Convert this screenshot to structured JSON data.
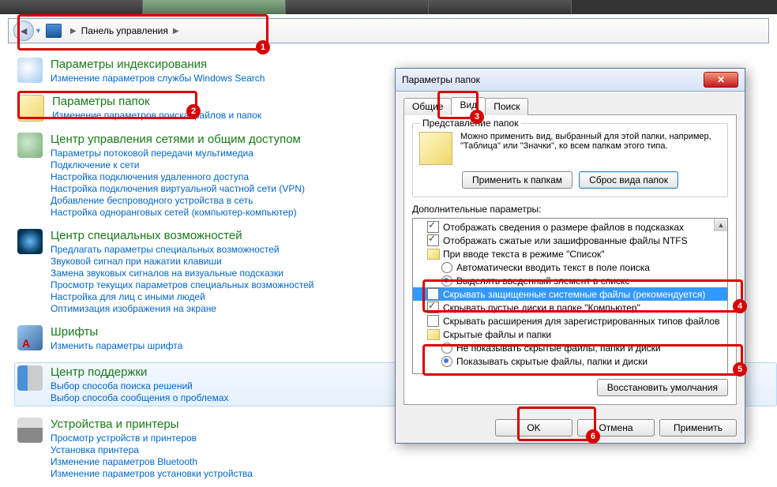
{
  "browser": {
    "tab_count": 4
  },
  "breadcrumb": {
    "control_panel": "Панель управления"
  },
  "categories": [
    {
      "id": "indexing",
      "icon": "ic-search",
      "title": "Параметры индексирования",
      "links": [
        "Изменение параметров службы Windows Search"
      ]
    },
    {
      "id": "folder-options",
      "icon": "ic-folder",
      "title": "Параметры папок",
      "links": [
        "Изменение параметров поиска файлов и папок"
      ]
    },
    {
      "id": "network",
      "icon": "ic-network",
      "title": "Центр управления сетями и общим доступом",
      "links": [
        "Параметры потоковой передачи мультимедиа",
        "Подключение к сети",
        "Настройка подключения удаленного доступа",
        "Настройка подключения виртуальной частной сети (VPN)",
        "Добавление беспроводного устройства в сеть",
        "Настройка одноранговых сетей (компьютер-компьютер)"
      ]
    },
    {
      "id": "ease-access",
      "icon": "ic-access",
      "title": "Центр специальных возможностей",
      "links": [
        "Предлагать параметры специальных возможностей",
        "Звуковой сигнал при нажатии клавиши",
        "Замена звуковых сигналов на визуальные подсказки",
        "Просмотр текущих параметров специальных возможностей",
        "Настройка для лиц с иными людей",
        "Оптимизация изображения на экране"
      ]
    },
    {
      "id": "fonts",
      "icon": "ic-fonts",
      "title": "Шрифты",
      "links": [
        "Изменить параметры шрифта"
      ]
    },
    {
      "id": "action-center",
      "icon": "ic-flag",
      "title": "Центр поддержки",
      "selected": true,
      "links": [
        "Выбор способа поиска решений",
        "Выбор способа сообщения о проблемах"
      ]
    },
    {
      "id": "devices",
      "icon": "ic-printer",
      "title": "Устройства и принтеры",
      "links": [
        "Просмотр устройств и принтеров",
        "Установка принтера",
        "Изменение параметров Bluetooth",
        "Изменение параметров установки устройства"
      ]
    }
  ],
  "dialog": {
    "title": "Параметры папок",
    "tabs": {
      "general": "Общие",
      "view": "Вид",
      "search": "Поиск"
    },
    "group_title": "Представление папок",
    "group_text": "Можно применить вид, выбранный для этой папки, например, \"Таблица\" или \"Значки\", ко всем папкам этого типа.",
    "apply_to_folders": "Применить к папкам",
    "reset_folders": "Сброс вида папок",
    "advanced_label": "Дополнительные параметры:",
    "tree": [
      {
        "type": "chk",
        "checked": true,
        "indent": 1,
        "label": "Отображать сведения о размере файлов в подсказках"
      },
      {
        "type": "chk",
        "checked": true,
        "indent": 1,
        "label": "Отображать сжатые или зашифрованные файлы NTFS"
      },
      {
        "type": "folder",
        "indent": 1,
        "label": "При вводе текста в режиме \"Список\""
      },
      {
        "type": "radio",
        "checked": false,
        "indent": 2,
        "label": "Автоматически вводить текст в поле поиска"
      },
      {
        "type": "radio",
        "checked": true,
        "indent": 2,
        "label": "Выделять введенный элемент в списке"
      },
      {
        "type": "chk",
        "checked": false,
        "indent": 1,
        "label": "Скрывать защищенные системные файлы (рекомендуется)",
        "selected": true
      },
      {
        "type": "chk",
        "checked": true,
        "indent": 1,
        "label": "Скрывать пустые диски в папке \"Компьютер\""
      },
      {
        "type": "chk",
        "checked": false,
        "indent": 1,
        "label": "Скрывать расширения для зарегистрированных типов файлов"
      },
      {
        "type": "folder",
        "indent": 1,
        "label": "Скрытые файлы и папки"
      },
      {
        "type": "radio",
        "checked": false,
        "indent": 2,
        "label": "Не показывать скрытые файлы, папки и диски"
      },
      {
        "type": "radio",
        "checked": true,
        "indent": 2,
        "label": "Показывать скрытые файлы, папки и диски"
      }
    ],
    "restore_defaults": "Восстановить умолчания",
    "ok": "OK",
    "cancel": "Отмена",
    "apply": "Применить"
  },
  "annotations": {
    "n1": "1",
    "n2": "2",
    "n3": "3",
    "n4": "4",
    "n5": "5",
    "n6": "6"
  }
}
